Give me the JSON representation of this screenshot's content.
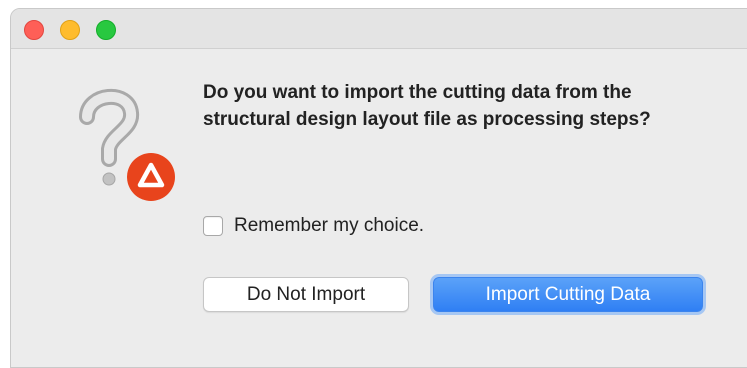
{
  "dialog": {
    "message": "Do you want to import the cutting data from the structural design layout file as processing steps?",
    "icon": "question-mark-with-warning-badge-icon",
    "checkbox": {
      "label": "Remember my choice.",
      "checked": false
    },
    "buttons": {
      "secondary_label": "Do Not Import",
      "primary_label": "Import Cutting Data"
    }
  },
  "colors": {
    "primary_button": "#3b84f5",
    "warning_badge": "#e8441c",
    "close_light": "#fe5f57",
    "minimize_light": "#febc2e",
    "zoom_light": "#28c840"
  }
}
